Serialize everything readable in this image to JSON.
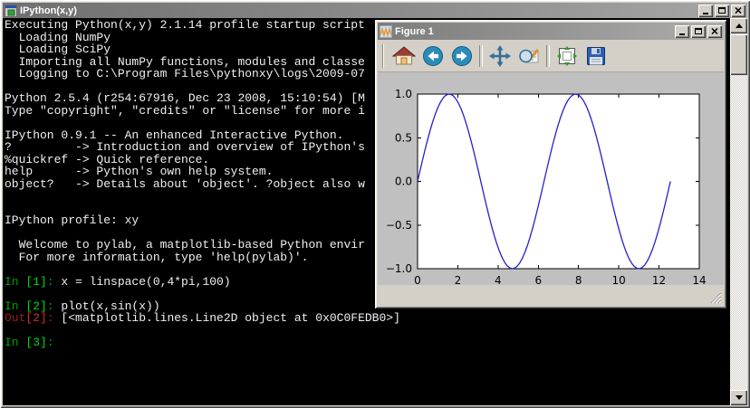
{
  "console_window": {
    "title": "IPython(x,y)",
    "title_icon": "console-app-icon",
    "window_controls": [
      "minimize",
      "maximize",
      "close"
    ],
    "colors": {
      "background": "#000000",
      "text": "#f0f0f0",
      "in_prompt": "#00a000",
      "in_number": "#00dc00",
      "out_prompt": "#9b1c1c",
      "out_number": "#d42a2a"
    },
    "lines": [
      [
        [
          "p",
          "Executing Python(x,y) 2.1.14 profile startup script"
        ]
      ],
      [
        [
          "p",
          "  Loading NumPy"
        ]
      ],
      [
        [
          "p",
          "  Loading SciPy"
        ]
      ],
      [
        [
          "p",
          "  Importing all NumPy functions, modules and classe"
        ]
      ],
      [
        [
          "p",
          "  Logging to C:\\Program Files\\pythonxy\\logs\\2009-07"
        ]
      ],
      [],
      [
        [
          "p",
          "Python 2.5.4 (r254:67916, Dec 23 2008, 15:10:54) [M"
        ]
      ],
      [
        [
          "p",
          "Type \"copyright\", \"credits\" or \"license\" for more i"
        ]
      ],
      [],
      [
        [
          "p",
          "IPython 0.9.1 -- An enhanced Interactive Python."
        ]
      ],
      [
        [
          "p",
          "?         -> Introduction and overview of IPython's"
        ]
      ],
      [
        [
          "p",
          "%quickref -> Quick reference."
        ]
      ],
      [
        [
          "p",
          "help      -> Python's own help system."
        ]
      ],
      [
        [
          "p",
          "object?   -> Details about 'object'. ?object also w"
        ]
      ],
      [],
      [],
      [
        [
          "p",
          "IPython profile: xy"
        ]
      ],
      [],
      [
        [
          "p",
          "  Welcome to pylab, a matplotlib-based Python envir"
        ]
      ],
      [
        [
          "p",
          "  For more information, type 'help(pylab)'."
        ]
      ],
      [],
      [
        [
          "gi",
          "In "
        ],
        [
          "gn",
          "[1]"
        ],
        [
          "gi",
          ": "
        ],
        [
          "p",
          "x = linspace(0,4*pi,100)"
        ]
      ],
      [],
      [
        [
          "gi",
          "In "
        ],
        [
          "gn",
          "[2]"
        ],
        [
          "gi",
          ": "
        ],
        [
          "p",
          "plot(x,sin(x))"
        ]
      ],
      [
        [
          "ro",
          "Out"
        ],
        [
          "rn",
          "[2]"
        ],
        [
          "ro",
          ": "
        ],
        [
          "p",
          "[<matplotlib.lines.Line2D object at 0x0C0FEDB0>]"
        ]
      ],
      [],
      [
        [
          "gi",
          "In "
        ],
        [
          "gn",
          "[3]"
        ],
        [
          "gi",
          ": "
        ]
      ]
    ],
    "scrollbar_icons": [
      "up-arrow-icon",
      "down-arrow-icon"
    ]
  },
  "figure_window": {
    "title": "Figure 1",
    "title_icon": "matplotlib-icon",
    "window_controls": [
      "minimize",
      "maximize",
      "close"
    ],
    "toolbar_icons": [
      "home-icon",
      "back-icon",
      "forward-icon",
      "pan-icon",
      "zoom-rect-icon",
      "configure-subplots-icon",
      "save-icon"
    ],
    "status_text": ""
  },
  "chart_data": {
    "type": "line",
    "title": "",
    "xlabel": "",
    "ylabel": "",
    "function": "sin",
    "x_start": 0,
    "x_end": 12.566370614359172,
    "n_points": 100,
    "xlim": [
      0,
      14
    ],
    "ylim": [
      -1,
      1
    ],
    "xtick_values": [
      0,
      2,
      4,
      6,
      8,
      10,
      12,
      14
    ],
    "xtick_labels": [
      "0",
      "2",
      "4",
      "6",
      "8",
      "10",
      "12",
      "14"
    ],
    "ytick_values": [
      -1,
      -0.5,
      0,
      0.5,
      1
    ],
    "ytick_labels": [
      "−1.0",
      "−0.5",
      "0.0",
      "0.5",
      "1.0"
    ],
    "line_color": "#2222cc",
    "axes_facecolor": "#ffffff",
    "figure_facecolor": "#c0c0c0",
    "grid": false,
    "legend": null
  }
}
